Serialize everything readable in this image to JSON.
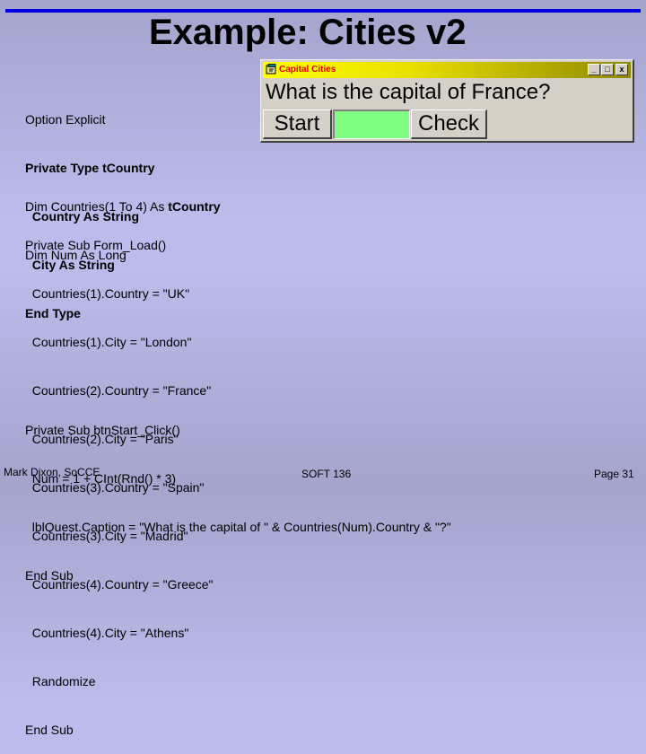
{
  "slide": {
    "title": "Example: Cities v2",
    "code_blocks": [
      {
        "lines": [
          {
            "text": "Option Explicit",
            "bold": false
          },
          {
            "text": "Private Type tCountry",
            "bold": true
          },
          {
            "text": "  Country As String",
            "bold": true
          },
          {
            "text": "  City As String",
            "bold": true
          },
          {
            "text": "End Type",
            "bold": true
          }
        ]
      },
      {
        "lines": [
          {
            "text": "Dim Countries(1 To 4) As ",
            "bold_suffix": "tCountry"
          },
          {
            "text": "Dim Num As Long"
          }
        ]
      },
      {
        "lines": [
          "Private Sub Form_Load()",
          "  Countries(1).Country = \"UK\"",
          "  Countries(1).City = \"London\"",
          "  Countries(2).Country = \"France\"",
          "  Countries(2).City = \"Paris\"",
          "  Countries(3).Country = \"Spain\"",
          "  Countries(3).City = \"Madrid\"",
          "  Countries(4).Country = \"Greece\"",
          "  Countries(4).City = \"Athens\"",
          "  Randomize",
          "End Sub"
        ]
      },
      {
        "lines": [
          "Private Sub btnStart_Click()",
          "  Num = 1 + CInt(Rnd() * 3)",
          "  lblQuest.Caption = \"What is the capital of \" & Countries(Num).Country & \"?\"",
          "End Sub"
        ]
      }
    ],
    "footer": {
      "author": "Mark Dixon, SoCCE",
      "course": "SOFT 136",
      "page": "Page 31"
    }
  },
  "app_window": {
    "title": "Capital Cities",
    "question_label": "What is the capital of France?",
    "start_button": "Start",
    "check_button": "Check",
    "answer_value": "",
    "answer_bg_color": "#80ff80",
    "controls": {
      "minimize": "_",
      "maximize": "□",
      "close": "x"
    }
  },
  "colors": {
    "accent_line": "#0000e0",
    "titlebar_start": "#ffff00",
    "titlebar_end": "#908800",
    "window_title_text": "#e00000"
  }
}
